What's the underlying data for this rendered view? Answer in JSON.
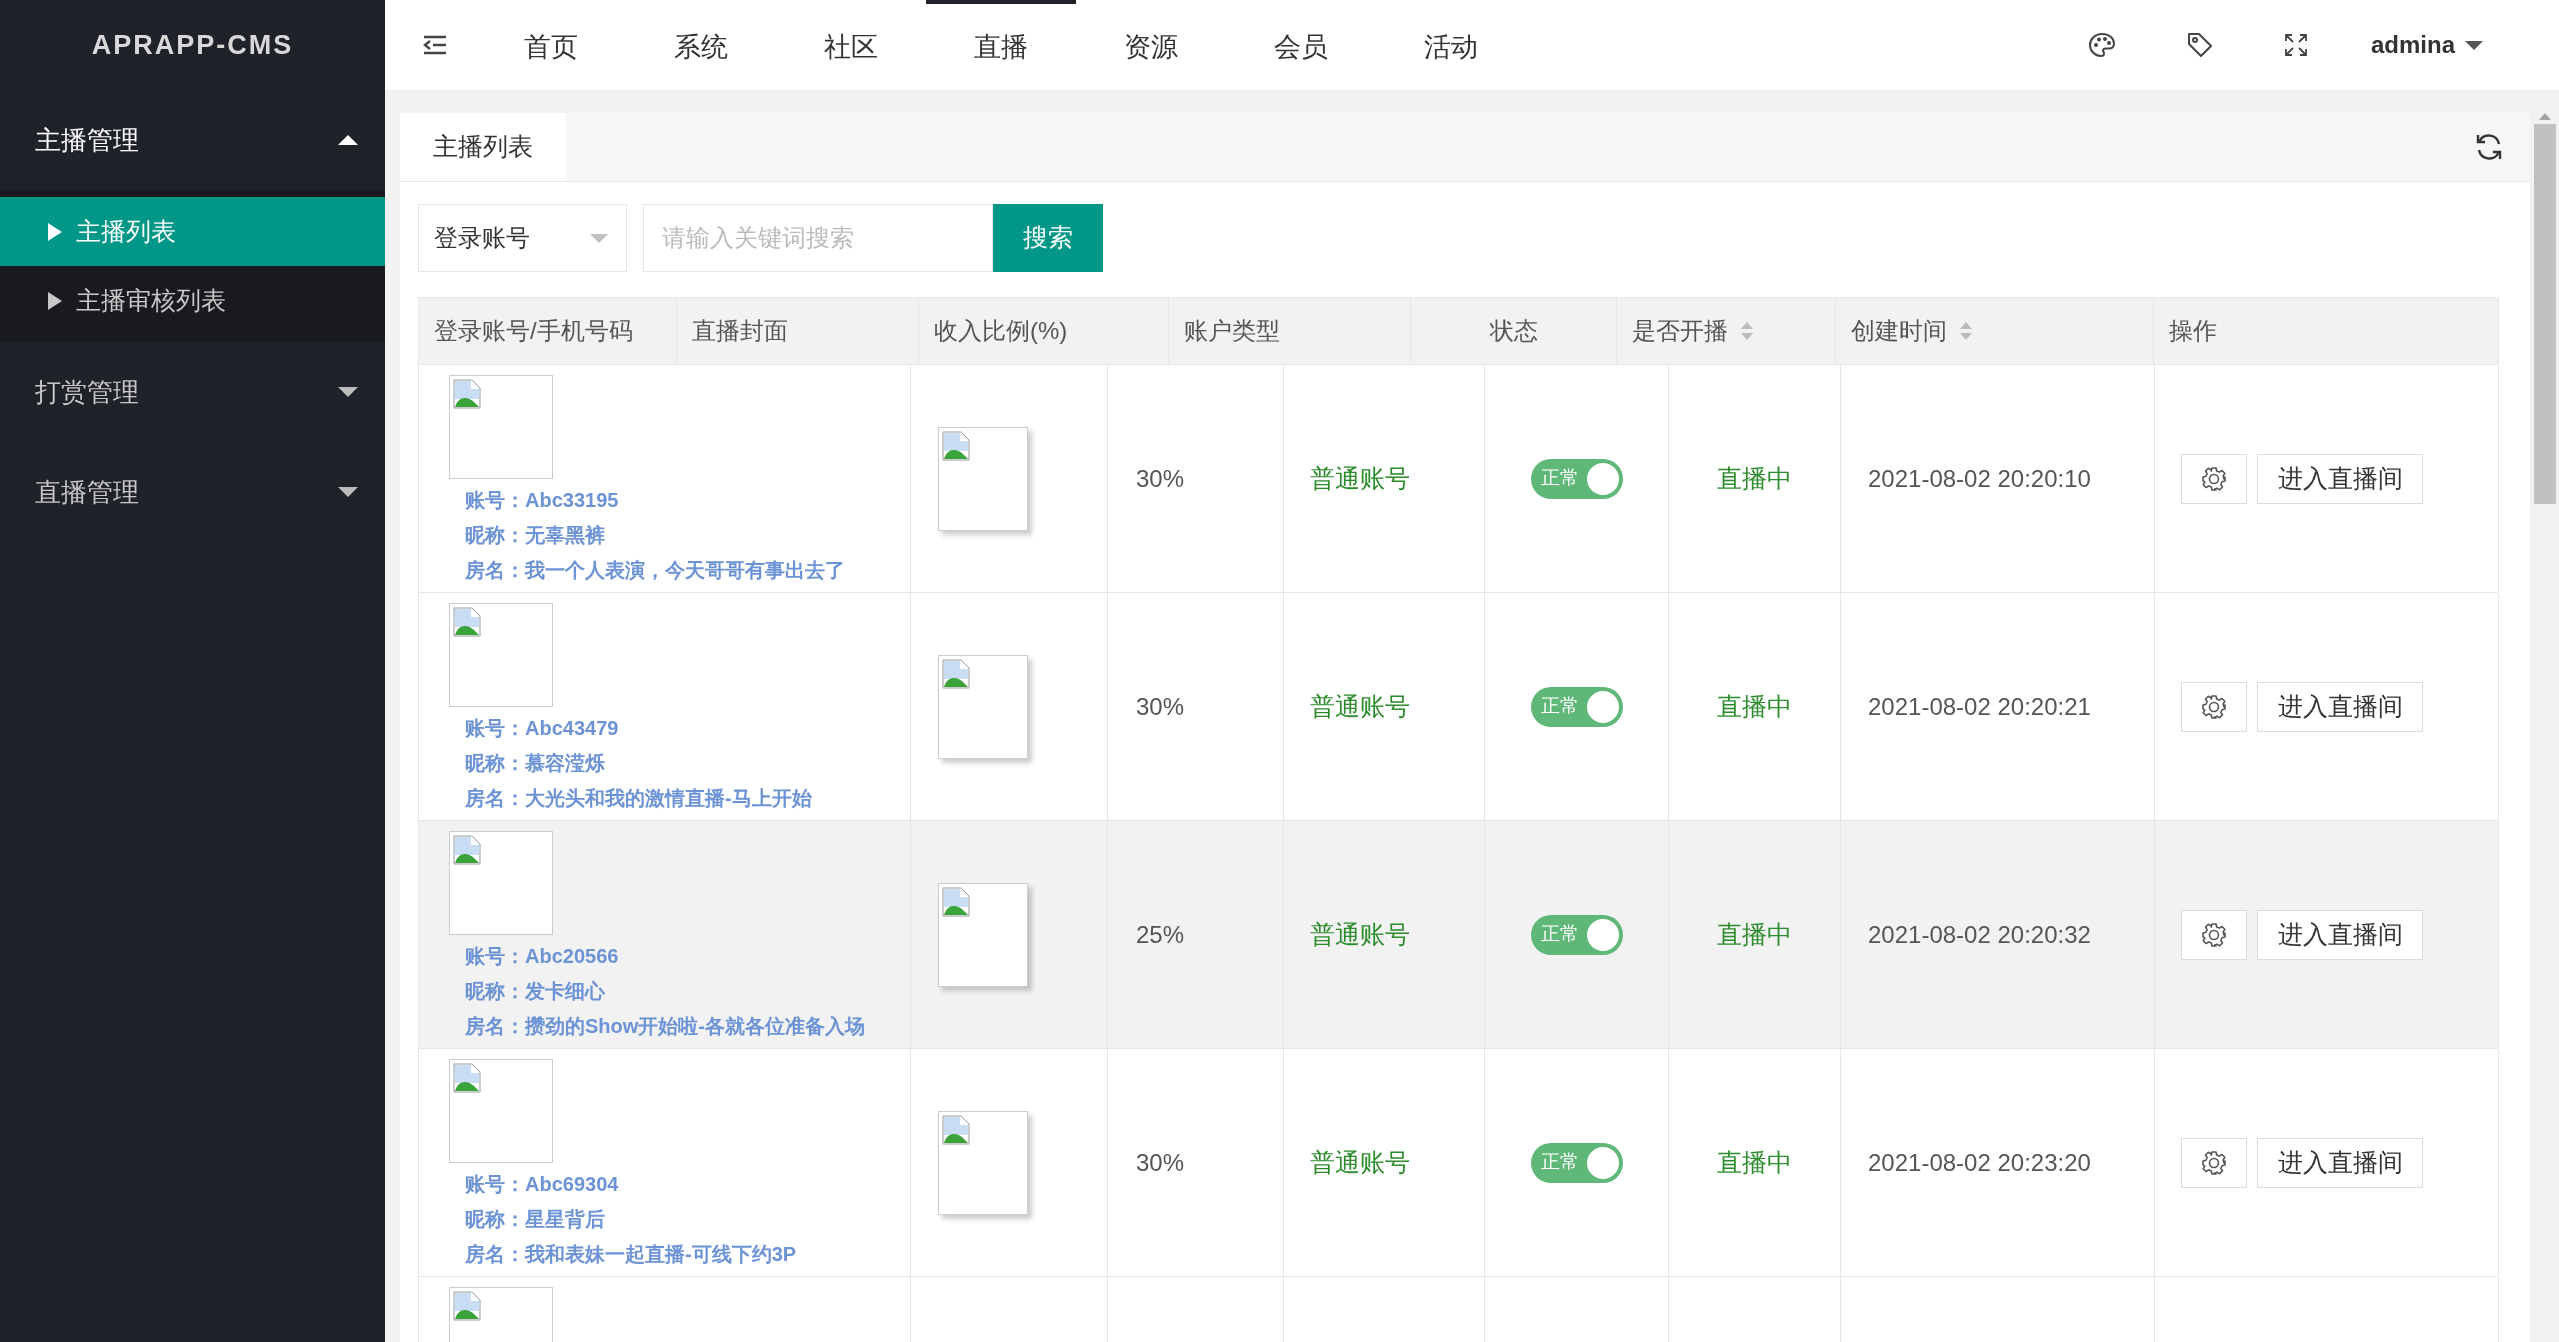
{
  "app": {
    "logo": "APRAPP-CMS"
  },
  "sidebar": {
    "groups": [
      {
        "label": "主播管理",
        "expanded": true,
        "children": [
          {
            "label": "主播列表",
            "selected": true
          },
          {
            "label": "主播审核列表",
            "selected": false
          }
        ]
      },
      {
        "label": "打赏管理",
        "expanded": false
      },
      {
        "label": "直播管理",
        "expanded": false
      }
    ]
  },
  "topnav": {
    "items": [
      {
        "label": "首页",
        "selected": false
      },
      {
        "label": "系统",
        "selected": false
      },
      {
        "label": "社区",
        "selected": false
      },
      {
        "label": "直播",
        "selected": true
      },
      {
        "label": "资源",
        "selected": false
      },
      {
        "label": "会员",
        "selected": false
      },
      {
        "label": "活动",
        "selected": false
      }
    ],
    "user": "admina"
  },
  "tabs": [
    {
      "label": "主播列表",
      "selected": true
    }
  ],
  "search": {
    "field": "登录账号",
    "placeholder": "请输入关键词搜索",
    "button": "搜索"
  },
  "table": {
    "columns": [
      {
        "label": "登录账号/手机号码",
        "sortable": false
      },
      {
        "label": "直播封面",
        "sortable": false
      },
      {
        "label": "收入比例(%)",
        "sortable": false
      },
      {
        "label": "账户类型",
        "sortable": false
      },
      {
        "label": "状态",
        "sortable": false
      },
      {
        "label": "是否开播",
        "sortable": true
      },
      {
        "label": "创建时间",
        "sortable": true
      },
      {
        "label": "操作",
        "sortable": false
      }
    ],
    "rows": [
      {
        "account": "账号：Abc33195",
        "nickname": "昵称：无辜黑裤",
        "room": "房名：我一个人表演，今天哥哥有事出去了",
        "ratio": "30%",
        "type": "普通账号",
        "status": {
          "label": "正常",
          "on": true
        },
        "live": "直播中",
        "created": "2021-08-02 20:20:10",
        "action": "进入直播间",
        "highlighted": false
      },
      {
        "account": "账号：Abc43479",
        "nickname": "昵称：慕容滢烁",
        "room": "房名：大光头和我的激情直播-马上开始",
        "ratio": "30%",
        "type": "普通账号",
        "status": {
          "label": "正常",
          "on": true
        },
        "live": "直播中",
        "created": "2021-08-02 20:20:21",
        "action": "进入直播间",
        "highlighted": false
      },
      {
        "account": "账号：Abc20566",
        "nickname": "昵称：发卡细心",
        "room": "房名：攒劲的Show开始啦-各就各位准备入场",
        "ratio": "25%",
        "type": "普通账号",
        "status": {
          "label": "正常",
          "on": true
        },
        "live": "直播中",
        "created": "2021-08-02 20:20:32",
        "action": "进入直播间",
        "highlighted": true
      },
      {
        "account": "账号：Abc69304",
        "nickname": "昵称：星星背后",
        "room": "房名：我和表妹一起直播-可线下约3P",
        "ratio": "30%",
        "type": "普通账号",
        "status": {
          "label": "正常",
          "on": true
        },
        "live": "直播中",
        "created": "2021-08-02 20:23:20",
        "action": "进入直播间",
        "highlighted": false
      }
    ]
  }
}
